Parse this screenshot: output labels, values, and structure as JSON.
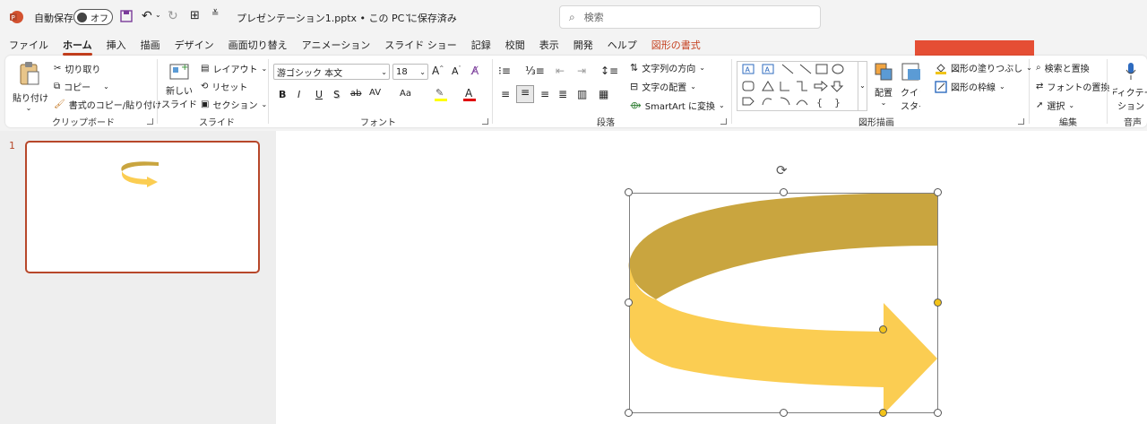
{
  "titlebar": {
    "autosave_label": "自動保存",
    "autosave_state": "オフ",
    "filename": "プレゼンテーション1.pptx • この PC に保存済み",
    "search_placeholder": "検索"
  },
  "tabs": [
    "ファイル",
    "ホーム",
    "挿入",
    "描画",
    "デザイン",
    "画面切り替え",
    "アニメーション",
    "スライド ショー",
    "記録",
    "校閲",
    "表示",
    "開発",
    "ヘルプ",
    "図形の書式"
  ],
  "active_tab": "ホーム",
  "ribbon": {
    "clipboard": {
      "paste": "貼り付け",
      "cut": "切り取り",
      "copy": "コピー",
      "format_painter": "書式のコピー/貼り付け",
      "label": "クリップボード"
    },
    "slides": {
      "new_slide_1": "新しい",
      "new_slide_2": "スライド",
      "layout": "レイアウト",
      "reset": "リセット",
      "section": "セクション",
      "label": "スライド"
    },
    "font": {
      "font_name": "游ゴシック 本文",
      "font_size": "18",
      "bold": "B",
      "italic": "I",
      "underline": "U",
      "shadow": "S",
      "strike": "ab",
      "spacing": "AV",
      "case": "Aa",
      "label": "フォント"
    },
    "paragraph": {
      "text_direction": "文字列の方向",
      "align_text": "文字の配置",
      "smartart": "SmartArt に変換",
      "label": "段落"
    },
    "drawing": {
      "arrange": "配置",
      "quick_styles_1": "クイック",
      "quick_styles_2": "スタイル",
      "shape_fill": "図形の塗りつぶし",
      "shape_outline": "図形の枠線",
      "label": "図形描画"
    },
    "editing": {
      "find_replace": "検索と置換",
      "replace_font": "フォントの置換",
      "select": "選択",
      "label": "編集"
    },
    "voice": {
      "dictate_1": "ディクテー",
      "dictate_2": "ション",
      "label": "音声"
    }
  },
  "slides_panel": {
    "slide_number": "1"
  },
  "colors": {
    "accent": "#c43e1c",
    "highlight_box": "#e54e34",
    "arrow_top": "#c9a53f",
    "arrow_front": "#fbcd52"
  }
}
